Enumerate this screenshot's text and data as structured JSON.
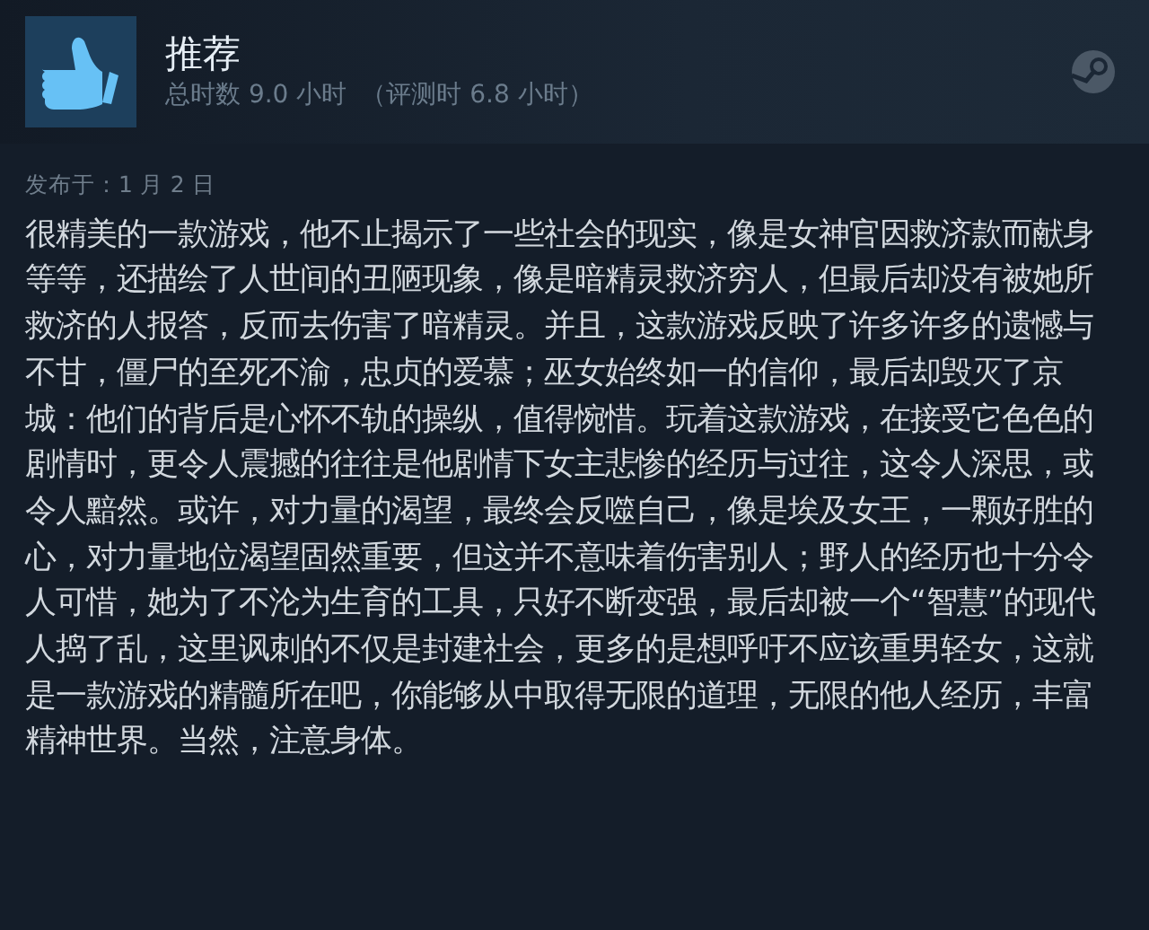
{
  "review": {
    "verdict": "推荐",
    "hours_total": "总时数 9.0 小时",
    "hours_at_review": "（评测时 6.8 小时）",
    "posted": "发布于：1 月 2 日",
    "body": "很精美的一款游戏，他不止揭示了一些社会的现实，像是女神官因救济款而献身等等，还描绘了人世间的丑陋现象，像是暗精灵救济穷人，但最后却没有被她所救济的人报答，反而去伤害了暗精灵。并且，这款游戏反映了许多许多的遗憾与不甘，僵尸的至死不渝，忠贞的爱慕；巫女始终如一的信仰，最后却毁灭了京城：他们的背后是心怀不轨的操纵，值得惋惜。玩着这款游戏，在接受它色色的剧情时，更令人震撼的往往是他剧情下女主悲惨的经历与过往，这令人深思，或令人黯然。或许，对力量的渴望，最终会反噬自己，像是埃及女王，一颗好胜的心，对力量地位渴望固然重要，但这并不意味着伤害别人；野人的经历也十分令人可惜，她为了不沦为生育的工具，只好不断变强，最后却被一个“智慧”的现代人捣了乱，这里讽刺的不仅是封建社会，更多的是想呼吁不应该重男轻女，这就是一款游戏的精髓所在吧，你能够从中取得无限的道理，无限的他人经历，丰富精神世界。当然，注意身体。"
  }
}
